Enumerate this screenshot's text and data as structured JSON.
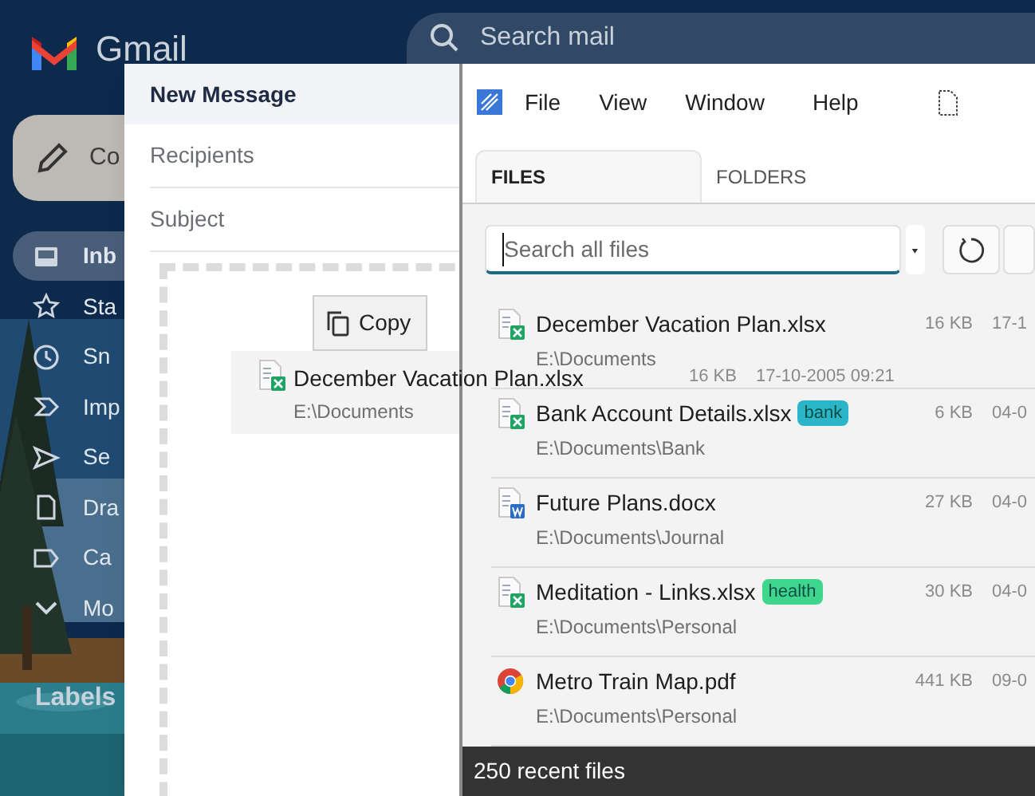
{
  "gmail": {
    "logo_text": "Gmail",
    "search": {
      "placeholder": "Search mail"
    },
    "compose_button": "Co",
    "nav": [
      {
        "label": "Inb",
        "selected": true
      },
      {
        "label": "Sta",
        "selected": false
      },
      {
        "label": "Sn",
        "selected": false
      },
      {
        "label": "Imp",
        "selected": false
      },
      {
        "label": "Se",
        "selected": false
      },
      {
        "label": "Dra",
        "selected": false
      },
      {
        "label": "Ca",
        "selected": false
      },
      {
        "label": "Mo",
        "selected": false
      }
    ],
    "labels_heading": "Labels"
  },
  "compose_window": {
    "title": "New Message",
    "recipients": {
      "placeholder": "Recipients"
    },
    "subject": {
      "placeholder": "Subject"
    },
    "drop_action": "Copy"
  },
  "drag_ghost": {
    "kind": "xlsx",
    "name": "December Vacation Plan.xlsx",
    "size": "16 KB",
    "modified": "17-10-2005 09:21",
    "path": "E:\\Documents"
  },
  "file_window": {
    "menu": [
      "File",
      "View",
      "Window",
      "Help"
    ],
    "tabs": [
      {
        "label": "FILES",
        "selected": true
      },
      {
        "label": "FOLDERS",
        "selected": false
      }
    ],
    "search": {
      "placeholder": "Search all files"
    },
    "files": [
      {
        "kind": "xlsx",
        "name": "December Vacation Plan.xlsx",
        "size": "16 KB",
        "date": "17-1",
        "path": "E:\\Documents"
      },
      {
        "kind": "xlsx",
        "name": "Bank Account Details.xlsx",
        "tag": {
          "label": "bank",
          "color": "#2bb5c9"
        },
        "size": "6 KB",
        "date": "04-0",
        "path": "E:\\Documents\\Bank"
      },
      {
        "kind": "docx",
        "name": "Future Plans.docx",
        "size": "27 KB",
        "date": "04-0",
        "path": "E:\\Documents\\Journal"
      },
      {
        "kind": "xlsx",
        "name": "Meditation - Links.xlsx",
        "tag": {
          "label": "health",
          "color": "#3ed68d"
        },
        "size": "30 KB",
        "date": "04-0",
        "path": "E:\\Documents\\Personal"
      },
      {
        "kind": "pdf",
        "name": "Metro Train Map.pdf",
        "size": "441 KB",
        "date": "09-0",
        "path": "E:\\Documents\\Personal"
      }
    ],
    "status_bar": "250 recent files"
  }
}
